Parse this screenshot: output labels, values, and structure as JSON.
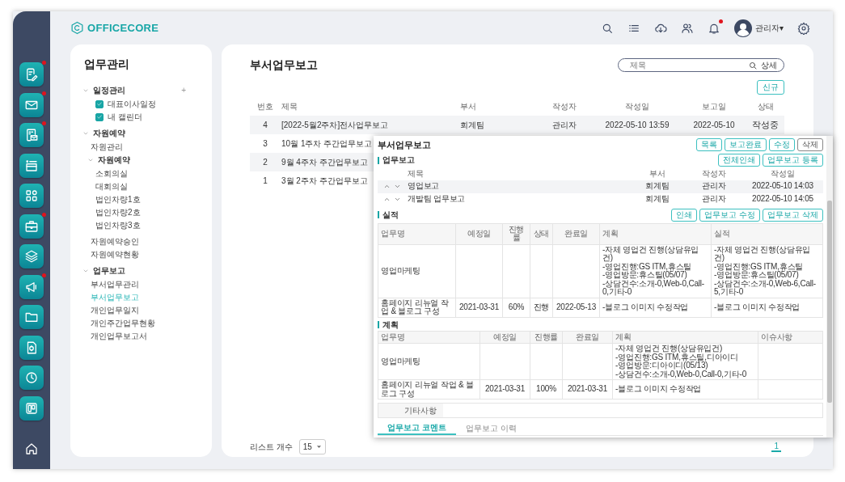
{
  "rail": [
    {
      "kind": "memo",
      "badge": true
    },
    {
      "kind": "mail",
      "badge": true
    },
    {
      "kind": "calmail",
      "badge": true
    },
    {
      "kind": "window",
      "badge": false
    },
    {
      "kind": "grid",
      "badge": false
    },
    {
      "kind": "briefcase",
      "badge": true
    },
    {
      "kind": "layers",
      "badge": false
    },
    {
      "kind": "megaphone",
      "badge": true
    },
    {
      "kind": "folder",
      "badge": false
    },
    {
      "kind": "document",
      "badge": false
    },
    {
      "kind": "clock",
      "badge": false
    },
    {
      "kind": "board",
      "badge": false
    }
  ],
  "rail_footer": {
    "kind": "home"
  },
  "header": {
    "logo": "OFFICECORE",
    "actions": [
      {
        "kind": "search",
        "badge": false
      },
      {
        "kind": "list",
        "badge": false
      },
      {
        "kind": "download",
        "badge": false
      },
      {
        "kind": "users",
        "badge": false
      },
      {
        "kind": "bell",
        "badge": true
      },
      {
        "kind": "user",
        "label": "관리자",
        "caret": "▾"
      },
      {
        "kind": "settings",
        "badge": false
      }
    ]
  },
  "sidebar": {
    "title": "업무관리",
    "tree": [
      {
        "kind": "group",
        "label": "일정관리",
        "expanded": true,
        "action": "+",
        "children": [
          {
            "kind": "checkbox",
            "label": "대표이사일정",
            "checked": true
          },
          {
            "kind": "checkbox",
            "label": "내 캘린더",
            "checked": true
          }
        ]
      },
      {
        "kind": "group",
        "label": "자원예약",
        "expanded": true,
        "children": [
          {
            "kind": "link",
            "label": "자원관리",
            "selected": false
          },
          {
            "kind": "group",
            "label": "자원예약",
            "expanded": true,
            "children": [
              {
                "kind": "link",
                "label": "소회의실",
                "selected": false
              },
              {
                "kind": "link",
                "label": "대회의실",
                "selected": false
              },
              {
                "kind": "link",
                "label": "법인차량1호",
                "selected": false
              },
              {
                "kind": "link",
                "label": "법인차량2호",
                "selected": false
              },
              {
                "kind": "link",
                "label": "법인차량3호",
                "selected": false
              }
            ]
          },
          {
            "kind": "link",
            "label": "자원예약승인",
            "selected": false
          },
          {
            "kind": "link",
            "label": "자원예약현황",
            "selected": false
          }
        ]
      },
      {
        "kind": "group",
        "label": "업무보고",
        "expanded": true,
        "children": [
          {
            "kind": "link",
            "label": "부서업무관리",
            "selected": false
          },
          {
            "kind": "link",
            "label": "부서업무보고",
            "selected": true
          },
          {
            "kind": "link",
            "label": "개인업무일지",
            "selected": false
          },
          {
            "kind": "link",
            "label": "개인주간업무현황",
            "selected": false
          },
          {
            "kind": "link",
            "label": "개인업무보고서",
            "selected": false
          }
        ]
      }
    ]
  },
  "main": {
    "title": "부서업무보고",
    "search": {
      "placeholder": "제목",
      "button": "상세"
    },
    "new_button": "신규",
    "table": {
      "columns": [
        "번호",
        "제목",
        "부서",
        "작성자",
        "작성일",
        "보고일",
        "상태"
      ],
      "rows": [
        {
          "cells": [
            "4",
            "[2022-5월2주차]전사업무보고",
            "회계팀",
            "관리자",
            "2022-05-10 13:59",
            "2022-05-10",
            "작성중"
          ]
        },
        {
          "cells": [
            "3",
            "10월 1주차 주간업무보고"
          ]
        },
        {
          "cells": [
            "2",
            "9월 4주차 주간업무보고"
          ]
        },
        {
          "cells": [
            "1",
            "3월 2주차 주간업무보고"
          ]
        }
      ]
    },
    "page_size_label": "리스트 개수",
    "page_size": "15",
    "pages": [
      {
        "label": "1",
        "selected": true
      }
    ]
  },
  "dialog": {
    "title": "부서업무보고",
    "actions": [
      {
        "label": "목록",
        "kind": "primary"
      },
      {
        "label": "보고완료",
        "kind": "primary"
      },
      {
        "label": "수정",
        "kind": "primary"
      },
      {
        "label": "삭제",
        "kind": "secondary"
      }
    ],
    "report": {
      "title": "업무보고",
      "buttons": [
        "전체인쇄",
        "업무보고 등록"
      ],
      "columns": [
        "제목",
        "부서",
        "작성자",
        "작성일"
      ],
      "rows": [
        {
          "cells": [
            "영업보고",
            "회계팀",
            "관리자",
            "2022-05-10 14:03"
          ]
        },
        {
          "cells": [
            "개발팀 업무보고",
            "회계팀",
            "관리자",
            "2022-05-10 14:05"
          ]
        }
      ]
    },
    "results": {
      "title": "실적",
      "buttons": [
        "인쇄",
        "업무보고 수정",
        "업무보고 삭제"
      ],
      "columns": [
        "업무명",
        "예정일",
        "진행률",
        "상태",
        "완료일",
        "계획",
        "실적"
      ],
      "rows": [
        {
          "cells": [
            "영업마케팅",
            "",
            "",
            "",
            "",
            "-자체 영업건 진행(상담유입건)\n-영업진행:GS ITM,휴스틸\n-영업방문:휴스틸(05/07)\n-상담건수:소개-0,Web-0,Call-0,기타-0",
            "-자체 영업건 진행(상담유입건)\n-영업진행:GS ITM,휴스틸\n-영업방문:휴스틸(05/07)\n-상담건수:소개-0,Web-6,Call-5,기타-0"
          ]
        },
        {
          "cells": [
            "홈페이지 리뉴얼 작업 & 블로그 구성",
            "2021-03-31",
            "60%",
            "진행",
            "2022-05-13",
            "-블로그 이미지 수정작업",
            "-블로그 이미지 수정작업"
          ]
        }
      ]
    },
    "plan": {
      "title": "계획",
      "columns": [
        "업무명",
        "예정일",
        "진행률",
        "완료일",
        "계획",
        "이슈사항"
      ],
      "rows": [
        {
          "cells": [
            "영업마케팅",
            "",
            "",
            "",
            "-자체 영업건 진행(상담유입건)\n-영업진행:GS ITM,휴스틸,디아이디\n-영업방문:디아이디(05/13)\n-상담건수:소개-0,Web-0,Call-0,기타-0",
            ""
          ]
        },
        {
          "cells": [
            "홈페이지 리뉴얼 작업 & 블로그 구성",
            "2021-03-31",
            "100%",
            "2021-03-31",
            "-블로그 이미지 수정작업",
            ""
          ]
        }
      ]
    },
    "notes_label": "기타사항",
    "tabs": [
      {
        "label": "업무보고 코멘트",
        "selected": true
      },
      {
        "label": "업무보고 이력",
        "selected": false
      }
    ]
  }
}
